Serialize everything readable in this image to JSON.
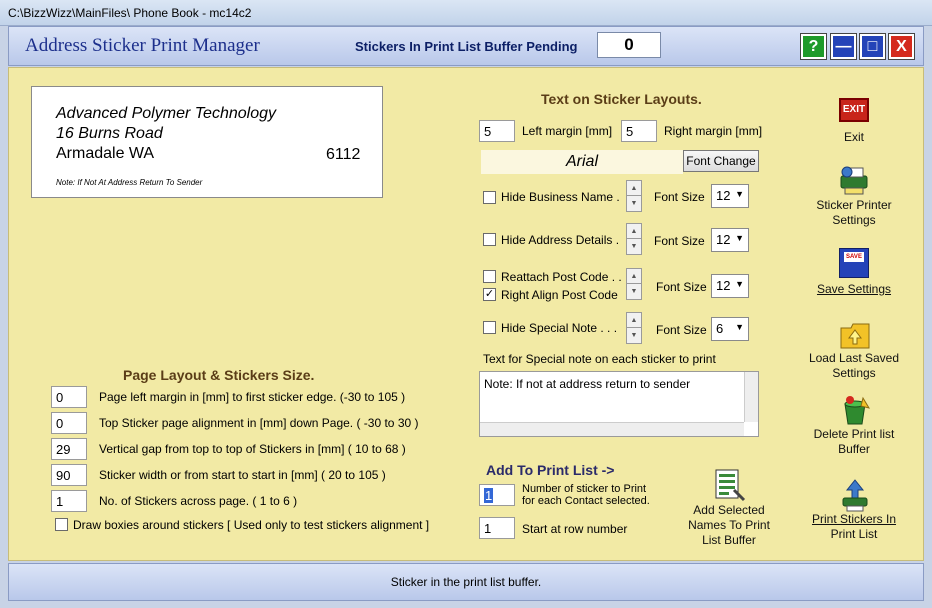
{
  "window": {
    "title": "C:\\BizzWizz\\MainFiles\\ Phone Book - mc14c2"
  },
  "header": {
    "app_title": "Address Sticker Print Manager",
    "pending_label": "Stickers In Print List Buffer Pending",
    "pending_count": "0",
    "buttons": {
      "help": "?",
      "minimize": "—",
      "maximize": "□",
      "close": "X"
    }
  },
  "preview": {
    "line1": "Advanced Polymer Technology",
    "line2": "16 Burns Road",
    "line3": "Armadale WA",
    "postcode": "6112",
    "note": "Note: If Not At Address Return To Sender"
  },
  "text_layouts": {
    "title": "Text on Sticker Layouts.",
    "left_margin_value": "5",
    "left_margin_label": "Left margin [mm]",
    "right_margin_value": "5",
    "right_margin_label": "Right margin [mm]",
    "font_name": "Arial",
    "font_change_label": "Font Change",
    "font_size_label": "Font Size",
    "hide_business": {
      "label": "Hide Business Name .",
      "checked": false,
      "size": "12"
    },
    "hide_address": {
      "label": "Hide Address Details .",
      "checked": false,
      "size": "12"
    },
    "reattach_postcode": {
      "label": "Reattach Post Code . .",
      "checked": false
    },
    "right_align_postcode": {
      "label": "Right Align Post Code",
      "checked": true,
      "size": "12"
    },
    "hide_special": {
      "label": "Hide Special Note . . .",
      "checked": false,
      "size": "6"
    },
    "special_note_label": "Text for Special note on each sticker to print",
    "special_note_text": "Note: If not at address return to sender"
  },
  "page_layout": {
    "title": "Page Layout & Stickers Size.",
    "rows": [
      {
        "value": "0",
        "label": "Page left margin in [mm]  to first sticker edge.  (-30 to 105 )"
      },
      {
        "value": "0",
        "label": "Top Sticker page alignment in [mm] down Page. ( -30 to 30 )"
      },
      {
        "value": "29",
        "label": "Vertical gap from top to top of Stickers in [mm]  ( 10 to 68 )"
      },
      {
        "value": "90",
        "label": "Sticker width or from start to start in [mm]  ( 20 to 105 )"
      },
      {
        "value": "1",
        "label": "No. of Stickers across page.  ( 1 to 6 )"
      }
    ],
    "draw_boxes_label": "Draw boxies around stickers [ Used only to test stickers alignment ]",
    "draw_boxes_checked": false
  },
  "print_list": {
    "title": "Add To Print List ->",
    "count_value": "1",
    "count_label_1": "Number of sticker to Print",
    "count_label_2": "for each Contact selected.",
    "start_row_value": "1",
    "start_row_label": "Start at row number",
    "add_selected_1": "Add Selected",
    "add_selected_2": "Names To Print",
    "add_selected_3": "List Buffer"
  },
  "actions": {
    "exit": "Exit",
    "printer_settings_1": "Sticker Printer",
    "printer_settings_2": "Settings",
    "save_settings": "Save Settings",
    "load_saved_1": "Load Last Saved",
    "load_saved_2": "Settings",
    "delete_buffer_1": "Delete Print list",
    "delete_buffer_2": "Buffer",
    "print_stickers_1": "Print Stickers In",
    "print_stickers_2": "Print List",
    "exit_icon_text": "EXIT",
    "save_icon_text": "SAVE"
  },
  "status": {
    "text": "Sticker in the print list buffer."
  },
  "colors": {
    "panel": "#f2eaa5",
    "header_text": "#1c2f8c",
    "section_text": "#5a3d17"
  }
}
